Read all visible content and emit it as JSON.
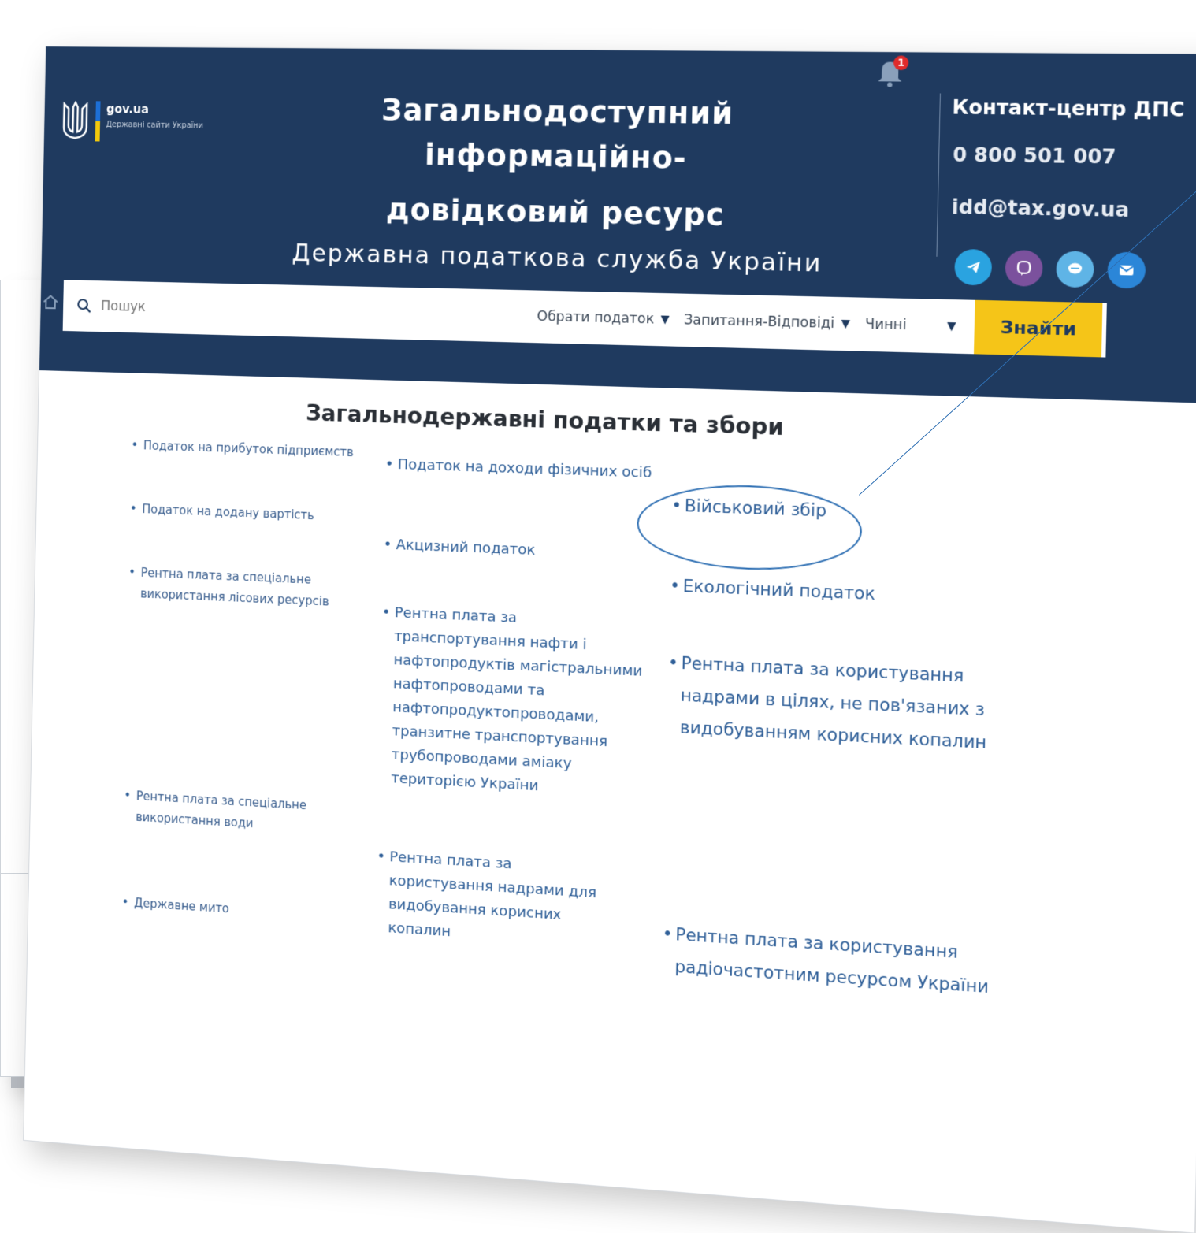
{
  "header": {
    "logo_domain": "gov.ua",
    "logo_sub": "Державні сайти України",
    "title_line1": "Загальнодоступний інформаційно-",
    "title_line2": "довідковий ресурс",
    "subtitle": "Державна податкова служба України",
    "notification_count": "1",
    "contact_title": "Контакт-центр ДПС",
    "contact_phone": "0 800 501 007",
    "contact_email": "idd@tax.gov.ua",
    "socials": [
      "telegram-icon",
      "viber-icon",
      "chat-icon",
      "mail-icon"
    ]
  },
  "search": {
    "placeholder": "Пошук",
    "dropdown_tax": "Обрати податок",
    "dropdown_qa": "Запитання-Відповіді",
    "dropdown_status": "Чинні",
    "find_label": "Знайти"
  },
  "section": {
    "title": "Загальнодержавні податки та збори"
  },
  "taxes": {
    "col_a": [
      "Податок на прибуток підприємств",
      "Податок на додану вартість",
      "Рентна плата за спеціальне використання лісових ресурсів",
      "Рентна плата за спеціальне використання води",
      "Державне мито"
    ],
    "col_b": [
      "Податок на доходи фізичних осіб",
      "Акцизний податок",
      "Рентна плата за транспортування нафти і нафтопродуктів магістральними нафтопроводами та нафтопродуктопроводами, транзитне транспортування трубопроводами аміаку територією України",
      "Рентна плата за користування надрами для видобування корисних копалин"
    ],
    "col_c": [
      "Військовий збір",
      "Екологічний податок",
      "Рентна плата за користування надрами в цілях, не пов'язаних з видобуванням корисних копалин",
      "Рентна плата за користування радіочастотним ресурсом України"
    ]
  },
  "colors": {
    "header_bg": "#1f3a5f",
    "accent_yellow": "#f5c518",
    "link_blue": "#2f5f98"
  }
}
